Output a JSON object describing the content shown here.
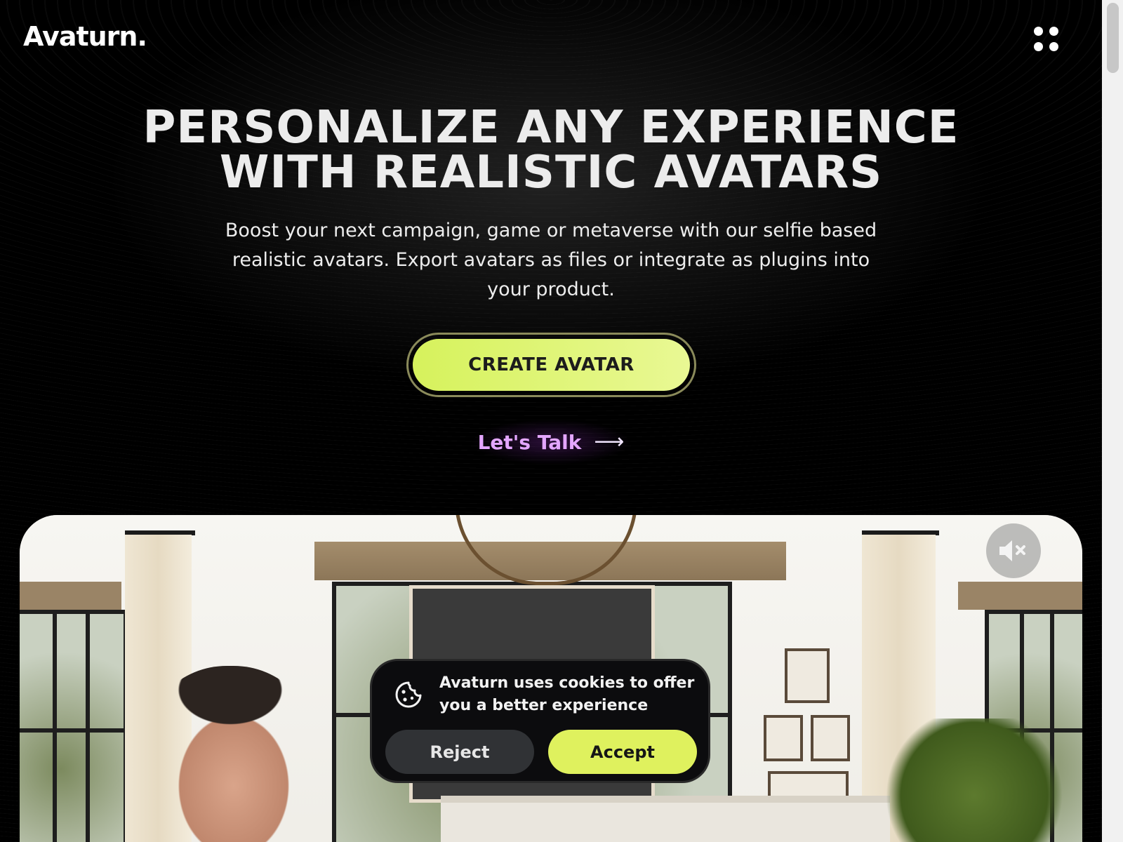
{
  "header": {
    "logo": "Avaturn.",
    "menu_icon": "dots-grid-icon"
  },
  "hero": {
    "headline_line1": "PERSONALIZE ANY EXPERIENCE",
    "headline_line2": "WITH REALISTIC AVATARS",
    "subtext_line1": "Boost your next campaign, game or metaverse with our selfie based",
    "subtext_line2": "realistic avatars. Export avatars as files or integrate as plugins into",
    "subtext_line3": "your product.",
    "cta_label": "CREATE AVATAR",
    "talk_label": "Let's Talk",
    "talk_icon": "arrow-right-icon"
  },
  "video": {
    "mute_icon": "speaker-muted-icon"
  },
  "cookie_banner": {
    "icon": "cookie-icon",
    "message_line1": "Avaturn uses cookies to offer",
    "message_line2": "you a better experience",
    "reject_label": "Reject",
    "accept_label": "Accept"
  },
  "colors": {
    "accent": "#dff15e",
    "talk": "#e3a6ff",
    "background": "#000000"
  }
}
